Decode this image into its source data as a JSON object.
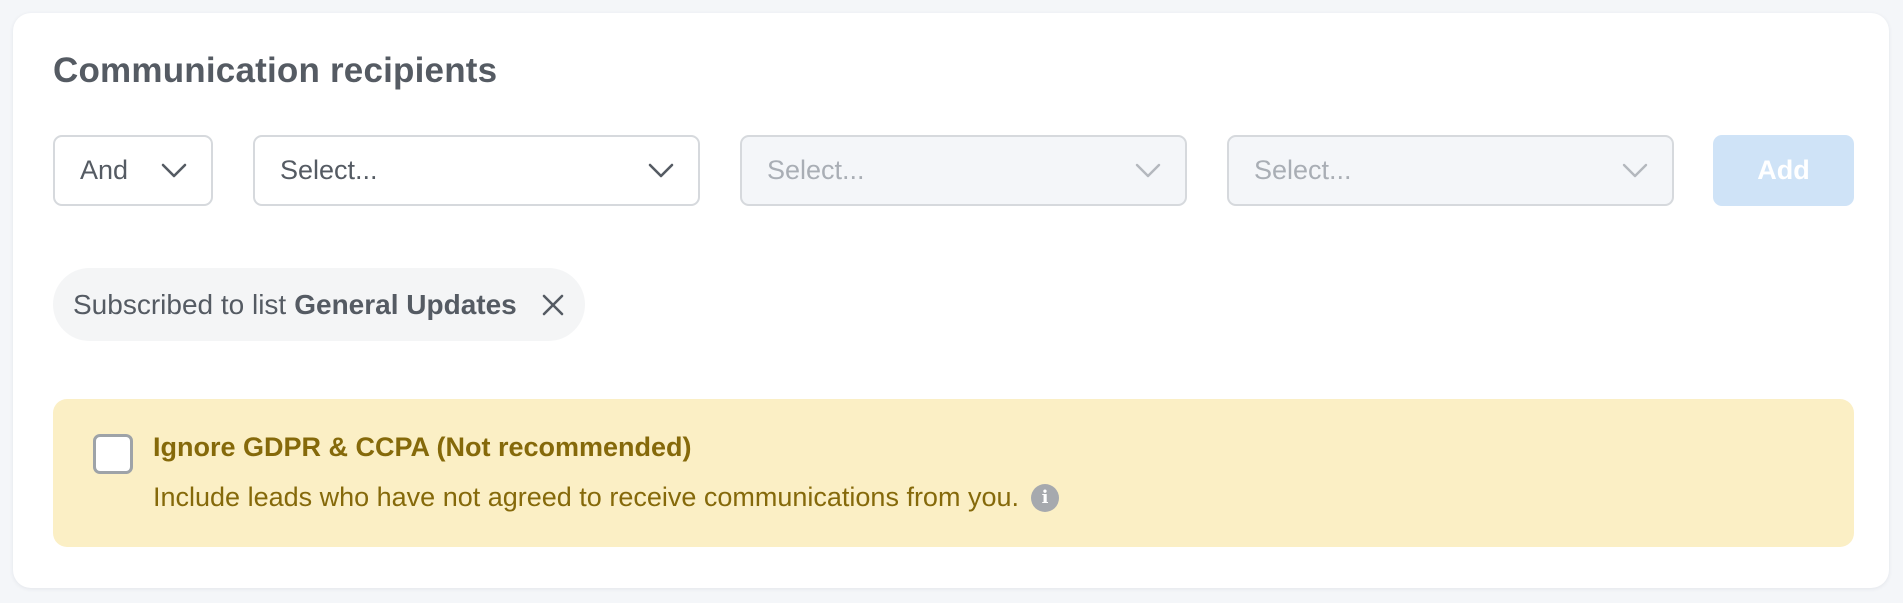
{
  "section": {
    "title": "Communication recipients"
  },
  "filters": {
    "operator": {
      "value": "And",
      "icon": "chevron-down-icon"
    },
    "select_1": {
      "placeholder": "Select...",
      "disabled": false,
      "icon": "chevron-down-icon"
    },
    "select_2": {
      "placeholder": "Select...",
      "disabled": true,
      "icon": "chevron-down-icon"
    },
    "select_3": {
      "placeholder": "Select...",
      "disabled": true,
      "icon": "chevron-down-icon"
    },
    "add_label": "Add"
  },
  "active_filters": [
    {
      "prefix": "Subscribed to list",
      "value": "General Updates",
      "remove_icon": "close-icon"
    }
  ],
  "gdpr": {
    "title": "Ignore GDPR & CCPA (Not recommended)",
    "description": "Include leads who have not agreed to receive communications from you.",
    "checked": false,
    "info_icon": "info-icon",
    "info_glyph": "i"
  },
  "colors": {
    "text": "#555b63",
    "add_button_disabled": "#cfe3f7",
    "warning_background": "#fbefc5",
    "warning_text": "#85690a"
  }
}
